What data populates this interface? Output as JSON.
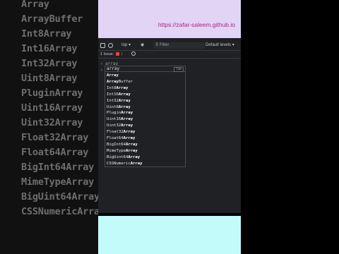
{
  "background_list": [
    "Array",
    "ArrayBuffer",
    "Int8Array",
    "Int16Array",
    "Int32Array",
    "Uint8Array",
    "PluginArray",
    "Uint16Array",
    "Uint32Array",
    "Float32Array",
    "Float64Array",
    "BigInt64Array",
    "MimeTypeArray",
    "BigUint64Array",
    "CSSNumericArray"
  ],
  "banner": {
    "url": "https://zafar-saleem.github.io"
  },
  "toolbar": {
    "context": "top",
    "filter_placeholder": "Filter",
    "levels": "Default levels"
  },
  "issues": {
    "label": "1 Issue:",
    "count": "1"
  },
  "console": {
    "typed": "array",
    "input_value": "array",
    "hint": "Tab",
    "suggestions": [
      {
        "pre": "",
        "bold": "Array",
        "post": ""
      },
      {
        "pre": "",
        "bold": "Array",
        "post": "Buffer"
      },
      {
        "pre": "Int8",
        "bold": "Array",
        "post": ""
      },
      {
        "pre": "Int16",
        "bold": "Array",
        "post": ""
      },
      {
        "pre": "Int32",
        "bold": "Array",
        "post": ""
      },
      {
        "pre": "Uint8",
        "bold": "Array",
        "post": ""
      },
      {
        "pre": "Plugin",
        "bold": "Array",
        "post": ""
      },
      {
        "pre": "Uint16",
        "bold": "Array",
        "post": ""
      },
      {
        "pre": "Uint32",
        "bold": "Array",
        "post": ""
      },
      {
        "pre": "Float32",
        "bold": "Array",
        "post": ""
      },
      {
        "pre": "Float64",
        "bold": "Array",
        "post": ""
      },
      {
        "pre": "BigInt64",
        "bold": "Array",
        "post": ""
      },
      {
        "pre": "MimeType",
        "bold": "Array",
        "post": ""
      },
      {
        "pre": "BigUint64",
        "bold": "Array",
        "post": ""
      },
      {
        "pre": "CSSNumeric",
        "bold": "Array",
        "post": ""
      }
    ]
  },
  "colors": {
    "banner_bg": "#e2d4f4",
    "url_color": "#b01f86",
    "devtools_bg": "#202124",
    "bottom_bg": "#c3fbfb"
  }
}
